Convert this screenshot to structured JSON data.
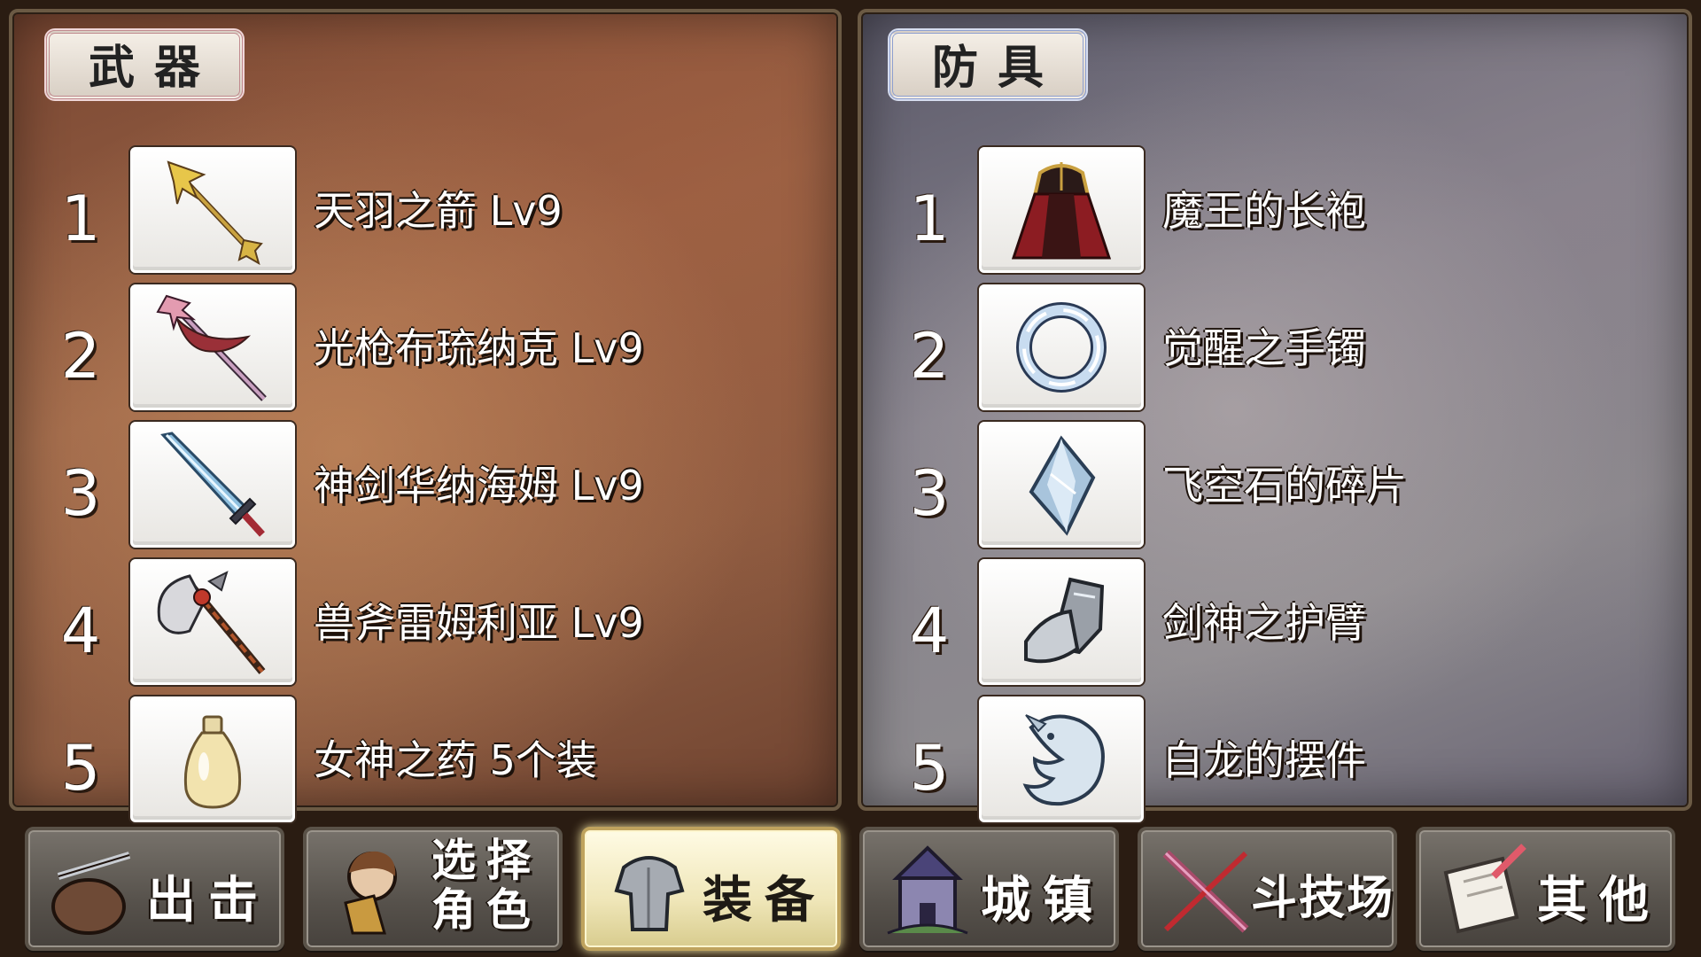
{
  "weapons": {
    "title": "武器",
    "items": [
      {
        "rank": "1",
        "name": "天羽之箭 Lv9",
        "icon": "arrow-icon"
      },
      {
        "rank": "2",
        "name": "光枪布琉纳克 Lv9",
        "icon": "spear-icon"
      },
      {
        "rank": "3",
        "name": "神剑华纳海姆 Lv9",
        "icon": "sword-icon"
      },
      {
        "rank": "4",
        "name": "兽斧雷姆利亚 Lv9",
        "icon": "axe-icon"
      },
      {
        "rank": "5",
        "name": "女神之药 5个装",
        "icon": "potion-icon"
      }
    ]
  },
  "armor": {
    "title": "防具",
    "items": [
      {
        "rank": "1",
        "name": "魔王的长袍",
        "icon": "robe-icon"
      },
      {
        "rank": "2",
        "name": "觉醒之手镯",
        "icon": "bracelet-icon"
      },
      {
        "rank": "3",
        "name": "飞空石的碎片",
        "icon": "crystal-icon"
      },
      {
        "rank": "4",
        "name": "剑神之护臂",
        "icon": "gauntlet-icon"
      },
      {
        "rank": "5",
        "name": "白龙的摆件",
        "icon": "dragon-figure-icon"
      }
    ]
  },
  "nav": {
    "sortie": "出击",
    "select_line1": "选择",
    "select_line2": "角色",
    "equipment": "装备",
    "town": "城镇",
    "arena": "斗技场",
    "other": "其他",
    "active": "equipment"
  },
  "colors": {
    "weapons_accent": "#c08a8e",
    "armor_accent": "#8e9fcf",
    "active_button": "#efe6b8"
  }
}
